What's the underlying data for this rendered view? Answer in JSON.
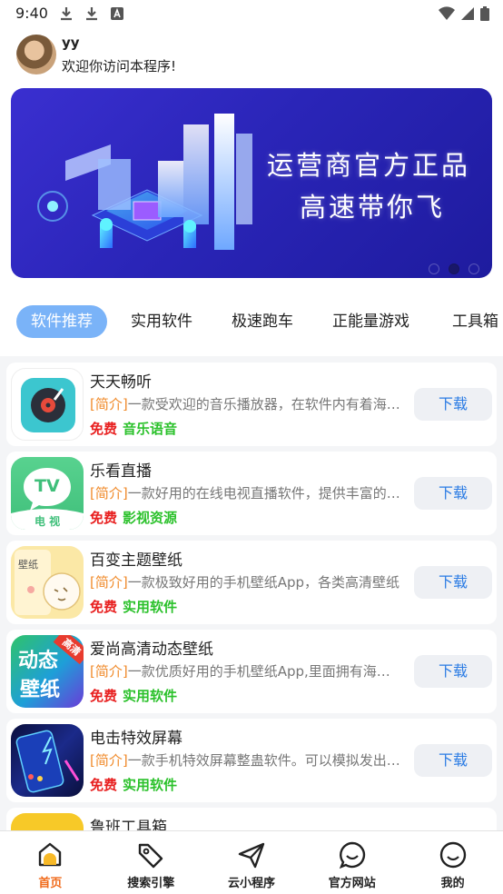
{
  "status_bar": {
    "time": "9:40",
    "left_icons": [
      "download-icon",
      "download-icon",
      "a-badge-icon"
    ],
    "right_icons": [
      "wifi-icon",
      "signal-icon",
      "battery-icon"
    ]
  },
  "header": {
    "username": "yy",
    "welcome": "欢迎你访问本程序!"
  },
  "banner": {
    "line1": "运营商官方正品",
    "line2": "高速带你飞",
    "dot_count": 3,
    "active_dot": 1
  },
  "tabs": [
    {
      "label": "软件推荐",
      "active": true
    },
    {
      "label": "实用软件",
      "active": false
    },
    {
      "label": "极速跑车",
      "active": false
    },
    {
      "label": "正能量游戏",
      "active": false
    },
    {
      "label": "工具箱",
      "active": false
    }
  ],
  "apps": [
    {
      "name": "天天畅听",
      "tag": "[简介]",
      "desc": "一款受欢迎的音乐播放器，在软件内有着海量音乐",
      "free": "免费",
      "category": "音乐语音",
      "button": "下载",
      "icon": "music-player-icon"
    },
    {
      "name": "乐看直播",
      "tag": "[简介]",
      "desc": "一款好用的在线电视直播软件，提供丰富的频道",
      "free": "免费",
      "category": "影视资源",
      "button": "下载",
      "icon": "tv-icon"
    },
    {
      "name": "百变主题壁纸",
      "tag": "[简介]",
      "desc": "一款极致好用的手机壁纸App，各类高清壁纸",
      "free": "免费",
      "category": "实用软件",
      "button": "下载",
      "icon": "wallpaper-icon"
    },
    {
      "name": "爱尚高清动态壁纸",
      "tag": "[简介]",
      "desc": "一款优质好用的手机壁纸App,里面拥有海量壁纸",
      "free": "免费",
      "category": "实用软件",
      "button": "下载",
      "icon": "live-wallpaper-icon"
    },
    {
      "name": "电击特效屏幕",
      "tag": "[简介]",
      "desc": "一款手机特效屏幕整蛊软件。可以模拟发出电击",
      "free": "免费",
      "category": "实用软件",
      "button": "下载",
      "icon": "electric-screen-icon"
    },
    {
      "name": "鲁班工具箱",
      "tag": "[简介]",
      "desc": "",
      "free": "",
      "category": "",
      "button": "",
      "icon": "toolbox-icon"
    }
  ],
  "icon_labels": {
    "tv_icon_text": "TV",
    "tv_icon_caption": "电 视",
    "wallpaper_icon_text": "壁纸",
    "live_icon_text_1": "动态",
    "live_icon_text_2": "壁纸",
    "live_icon_badge": "高清"
  },
  "bottom_nav": [
    {
      "label": "首页",
      "icon": "home-icon",
      "active": true
    },
    {
      "label": "搜索引擎",
      "icon": "tag-icon",
      "active": false
    },
    {
      "label": "云小程序",
      "icon": "paper-plane-icon",
      "active": false
    },
    {
      "label": "官方网站",
      "icon": "chat-smile-icon",
      "active": false
    },
    {
      "label": "我的",
      "icon": "smile-icon",
      "active": false
    }
  ],
  "colors": {
    "accent": "#7ab3f8",
    "free": "#e82020",
    "category": "#2bc12b",
    "tag": "#f08a2a",
    "download": "#2a7be4",
    "nav_active": "#f06a1a"
  }
}
